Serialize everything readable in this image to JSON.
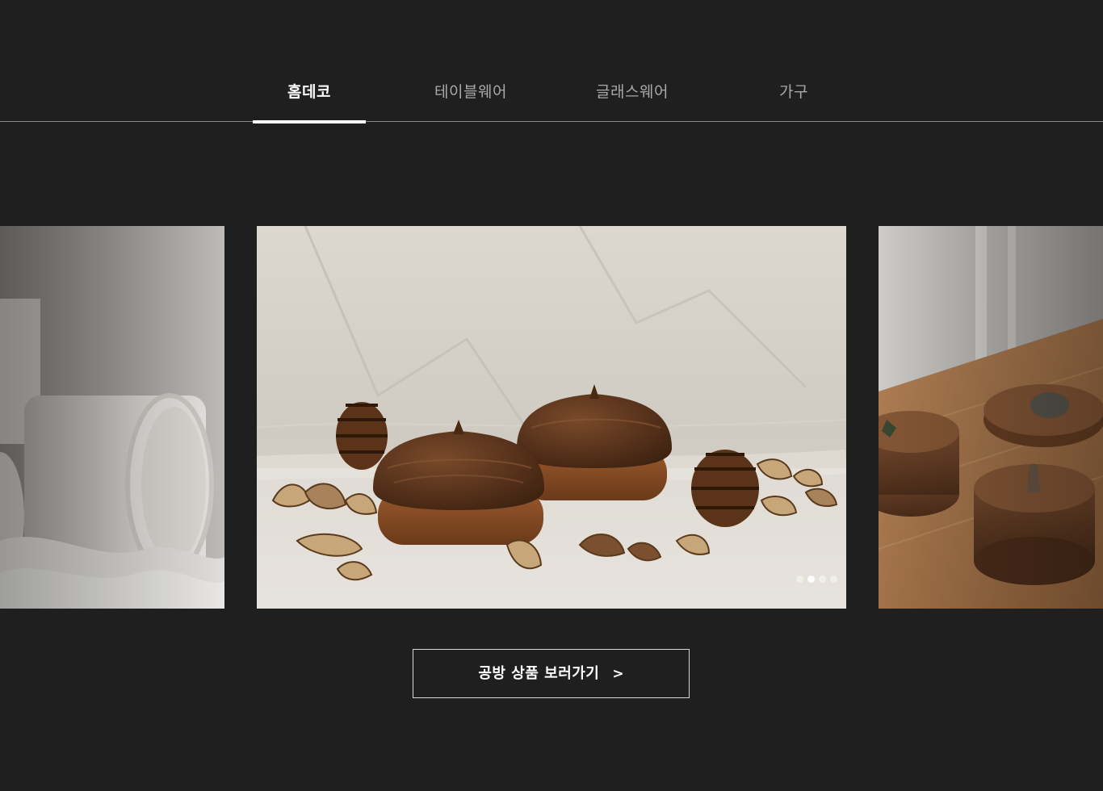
{
  "tabs": [
    {
      "label": "홈데코",
      "active": true
    },
    {
      "label": "테이블웨어",
      "active": false
    },
    {
      "label": "글래스웨어",
      "active": false
    },
    {
      "label": "가구",
      "active": false
    }
  ],
  "carousel": {
    "active_slide": 2,
    "slide_count": 4
  },
  "cta": {
    "label": "공방 상품 보러가기",
    "arrow": ">"
  },
  "colors": {
    "background": "#1f1f1f",
    "active_text": "#ffffff",
    "inactive_text": "#a9a9a9",
    "divider": "#8a8a8a"
  }
}
